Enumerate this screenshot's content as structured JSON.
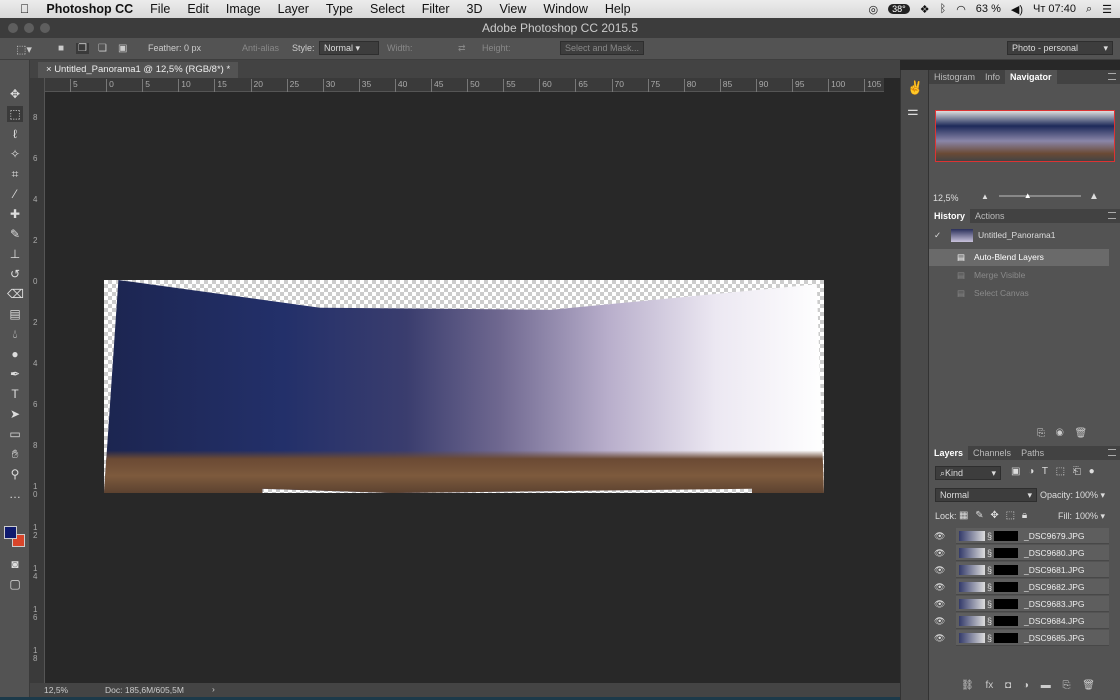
{
  "menubar": {
    "apple": "",
    "app": "Photoshop CC",
    "items": [
      "File",
      "Edit",
      "Image",
      "Layer",
      "Type",
      "Select",
      "Filter",
      "3D",
      "View",
      "Window",
      "Help"
    ],
    "temp": "38°",
    "battery": "63 %",
    "clock": "Чт 07:40"
  },
  "window": {
    "title": "Adobe Photoshop CC 2015.5"
  },
  "options": {
    "feather_label": "Feather:",
    "feather_value": "0 px",
    "antialias": "Anti-alias",
    "style_label": "Style:",
    "style_value": "Normal",
    "width_label": "Width:",
    "height_label": "Height:",
    "select_mask": "Select and Mask...",
    "workspace": "Photo - personal"
  },
  "document": {
    "tab": "Untitled_Panorama1 @ 12,5% (RGB/8*) *",
    "zoom": "12,5%",
    "doc_size": "Doc: 185,6M/605,5M"
  },
  "rulers": {
    "h": [
      "5",
      "0",
      "5",
      "10",
      "15",
      "20",
      "25",
      "30",
      "35",
      "40",
      "45",
      "50",
      "55",
      "60",
      "65",
      "70",
      "75",
      "80",
      "85",
      "90",
      "95",
      "100",
      "105"
    ],
    "v": [
      "8",
      "6",
      "4",
      "2",
      "0",
      "2",
      "4",
      "6",
      "8",
      "10",
      "12",
      "14",
      "16",
      "18"
    ]
  },
  "navigator": {
    "tabs": [
      "Histogram",
      "Info",
      "Navigator"
    ],
    "active": "Navigator",
    "zoom": "12,5%",
    "slider": 0.35
  },
  "history": {
    "tabs": [
      "History",
      "Actions"
    ],
    "snapshot": "Untitled_Panorama1",
    "items": [
      "Auto-Blend Layers",
      "Merge Visible",
      "Select Canvas"
    ],
    "active": 0
  },
  "layers": {
    "tabs": [
      "Layers",
      "Channels",
      "Paths"
    ],
    "filter": "Kind",
    "blend": "Normal",
    "opacity_label": "Opacity:",
    "opacity": "100%",
    "lock_label": "Lock:",
    "fill_label": "Fill:",
    "fill": "100%",
    "items": [
      "_DSC9679.JPG",
      "_DSC9680.JPG",
      "_DSC9681.JPG",
      "_DSC9682.JPG",
      "_DSC9683.JPG",
      "_DSC9684.JPG",
      "_DSC9685.JPG"
    ]
  },
  "colors": {
    "foreground": "#0f1a6e",
    "background": "#d8452a"
  }
}
